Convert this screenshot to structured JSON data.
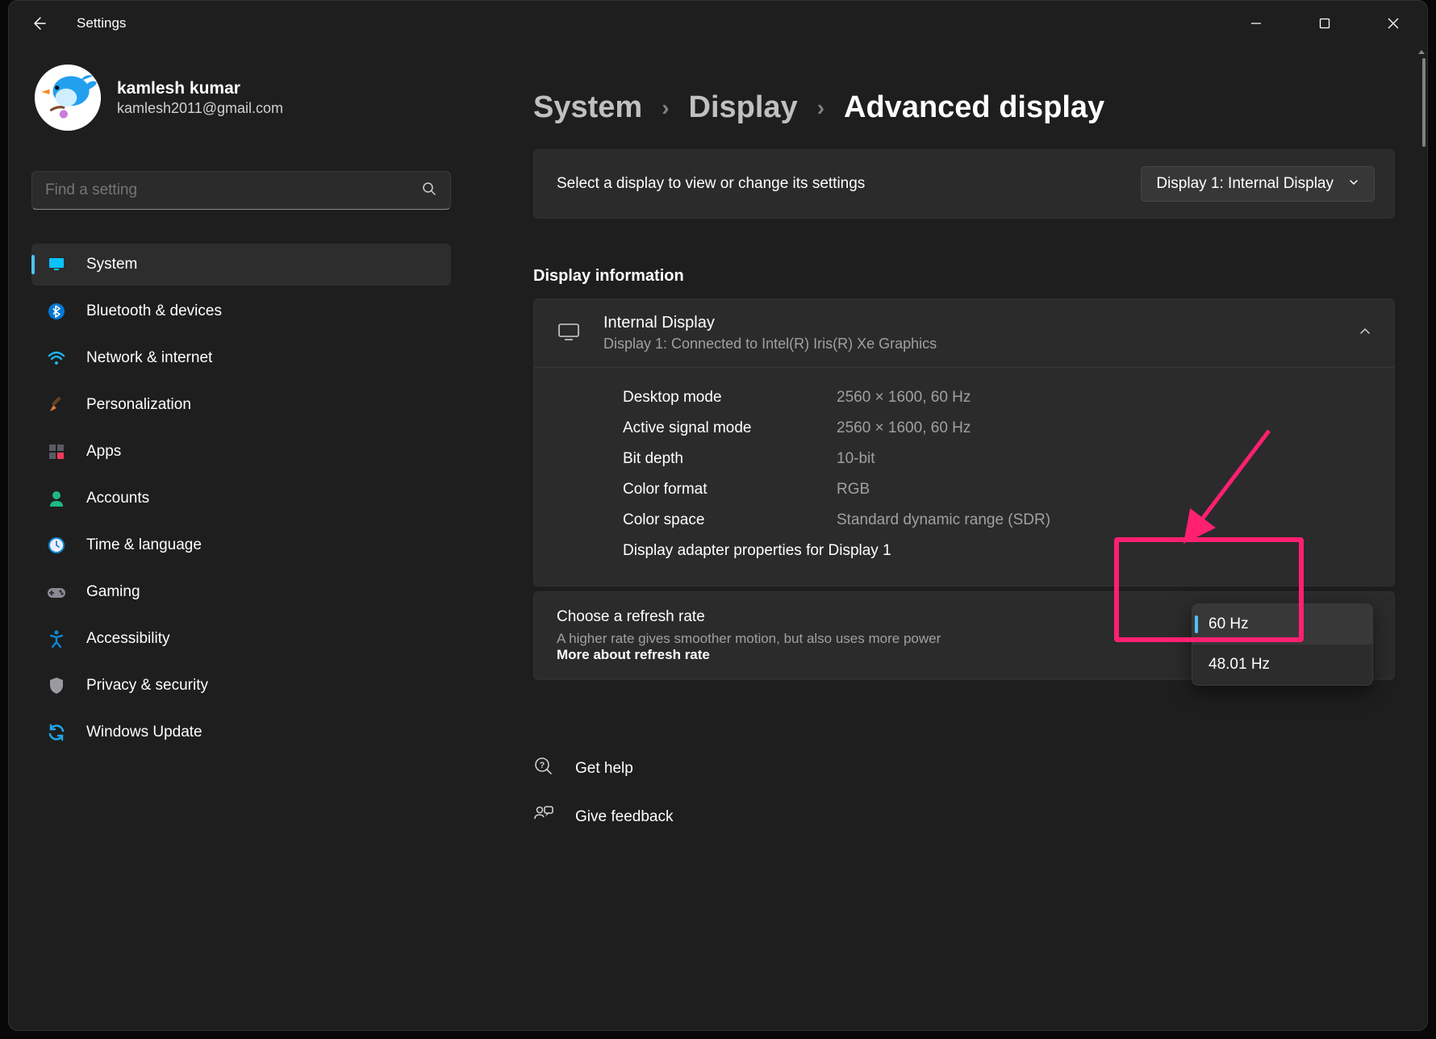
{
  "window": {
    "app_title": "Settings"
  },
  "profile": {
    "name": "kamlesh kumar",
    "email": "kamlesh2011@gmail.com"
  },
  "search": {
    "placeholder": "Find a setting"
  },
  "sidebar": {
    "items": [
      {
        "label": "System",
        "icon": "monitor",
        "active": true
      },
      {
        "label": "Bluetooth & devices",
        "icon": "bluetooth"
      },
      {
        "label": "Network & internet",
        "icon": "wifi"
      },
      {
        "label": "Personalization",
        "icon": "paint"
      },
      {
        "label": "Apps",
        "icon": "grid"
      },
      {
        "label": "Accounts",
        "icon": "person"
      },
      {
        "label": "Time & language",
        "icon": "clock"
      },
      {
        "label": "Gaming",
        "icon": "gamepad"
      },
      {
        "label": "Accessibility",
        "icon": "access"
      },
      {
        "label": "Privacy & security",
        "icon": "shield"
      },
      {
        "label": "Windows Update",
        "icon": "sync"
      }
    ]
  },
  "breadcrumb": {
    "items": [
      "System",
      "Display"
    ],
    "current": "Advanced display"
  },
  "display_selector": {
    "label": "Select a display to view or change its settings",
    "value": "Display 1: Internal Display"
  },
  "section": {
    "title": "Display information"
  },
  "display_info": {
    "title": "Internal Display",
    "subtitle": "Display 1: Connected to Intel(R) Iris(R) Xe Graphics",
    "rows": [
      {
        "k": "Desktop mode",
        "v": "2560 × 1600, 60 Hz"
      },
      {
        "k": "Active signal mode",
        "v": "2560 × 1600, 60 Hz"
      },
      {
        "k": "Bit depth",
        "v": "10-bit"
      },
      {
        "k": "Color format",
        "v": "RGB"
      },
      {
        "k": "Color space",
        "v": "Standard dynamic range (SDR)"
      }
    ],
    "adapter_link": "Display adapter properties for Display 1"
  },
  "refresh": {
    "title": "Choose a refresh rate",
    "subtitle": "A higher rate gives smoother motion, but also uses more power",
    "link": "More about refresh rate",
    "options": [
      "60 Hz",
      "48.01 Hz"
    ],
    "selected": "60 Hz"
  },
  "help": {
    "get_help": "Get help",
    "feedback": "Give feedback"
  }
}
